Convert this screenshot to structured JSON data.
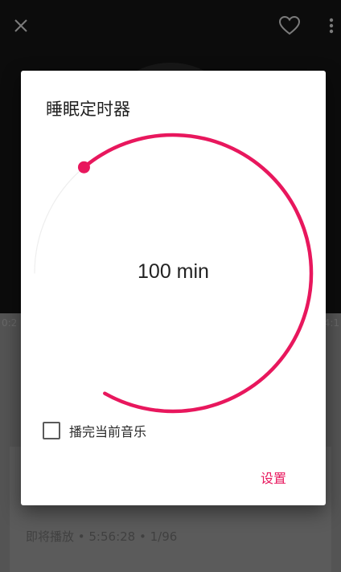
{
  "player": {
    "elapsed": "0:2",
    "total": "4:1",
    "up_next": "即将播放 • 5:56:28 • 1/96",
    "icons": {
      "close": "close-icon",
      "favorite": "heart-outline-icon",
      "more": "more-vert-icon"
    }
  },
  "dialog": {
    "title": "睡眠定时器",
    "timer_value": "100 min",
    "minutes": 100,
    "max_minutes": 120,
    "after_track_label": "播完当前音乐",
    "after_track_checked": false,
    "set_label": "设置"
  },
  "colors": {
    "accent": "#e8175d",
    "track": "#eeeeee",
    "dialog_bg": "#ffffff"
  }
}
